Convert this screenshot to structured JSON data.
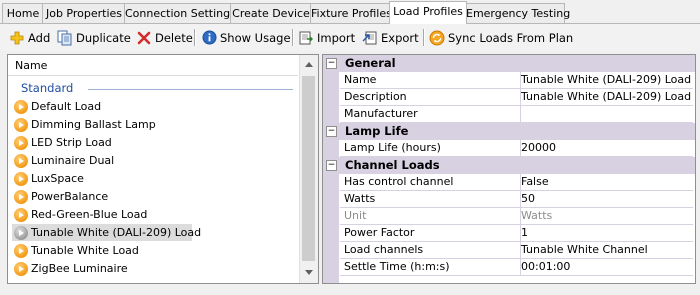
{
  "tabs": [
    {
      "label": "Home"
    },
    {
      "label": "Job Properties"
    },
    {
      "label": "Connection Settings"
    },
    {
      "label": "Create Device"
    },
    {
      "label": "Fixture Profiles"
    },
    {
      "label": "Load Profiles"
    },
    {
      "label": "Emergency Testing"
    }
  ],
  "active_tab": "Load Profiles",
  "toolbar": {
    "add_label": "Add",
    "duplicate_label": "Duplicate",
    "delete_label": "Delete",
    "show_usage_label": "Show Usage",
    "import_label": "Import",
    "export_label": "Export",
    "sync_label": "Sync Loads From Plan"
  },
  "list": {
    "header": "Name",
    "group_label": "Standard",
    "items": [
      {
        "label": "Default Load",
        "icon": "orange-play-icon"
      },
      {
        "label": "Dimming Ballast Lamp",
        "icon": "orange-play-icon"
      },
      {
        "label": "LED Strip Load",
        "icon": "orange-play-icon"
      },
      {
        "label": "Luminaire Dual",
        "icon": "orange-play-icon"
      },
      {
        "label": "LuxSpace",
        "icon": "orange-play-icon"
      },
      {
        "label": "PowerBalance",
        "icon": "orange-play-icon"
      },
      {
        "label": "Red-Green-Blue Load",
        "icon": "orange-play-icon"
      },
      {
        "label": "Tunable White (DALI-209) Load",
        "icon": "gray-play-icon",
        "selected": true
      },
      {
        "label": "Tunable White Load",
        "icon": "orange-play-icon"
      },
      {
        "label": "ZigBee Luminaire",
        "icon": "orange-play-icon"
      }
    ]
  },
  "properties": {
    "general": {
      "title": "General",
      "rows": [
        {
          "name": "Name",
          "value": "Tunable White (DALI-209) Load"
        },
        {
          "name": "Description",
          "value": "Tunable White (DALI-209) Load"
        },
        {
          "name": "Manufacturer",
          "value": ""
        }
      ]
    },
    "lamp_life": {
      "title": "Lamp Life",
      "rows": [
        {
          "name": "Lamp Life (hours)",
          "value": "20000"
        }
      ]
    },
    "channel_loads": {
      "title": "Channel Loads",
      "rows": [
        {
          "name": "Has control channel",
          "value": "False"
        },
        {
          "name": "Watts",
          "value": "50"
        },
        {
          "name": "Unit",
          "value": "Watts",
          "disabled": true
        },
        {
          "name": "Power Factor",
          "value": "1"
        },
        {
          "name": "Load channels",
          "value": "Tunable White Channel"
        },
        {
          "name": "Settle Time (h:m:s)",
          "value": "00:01:00"
        }
      ]
    }
  },
  "colors": {
    "category_bg": "#d7d1e2",
    "group_label": "#1f4ea0",
    "icon_orange": "#f29a16"
  }
}
